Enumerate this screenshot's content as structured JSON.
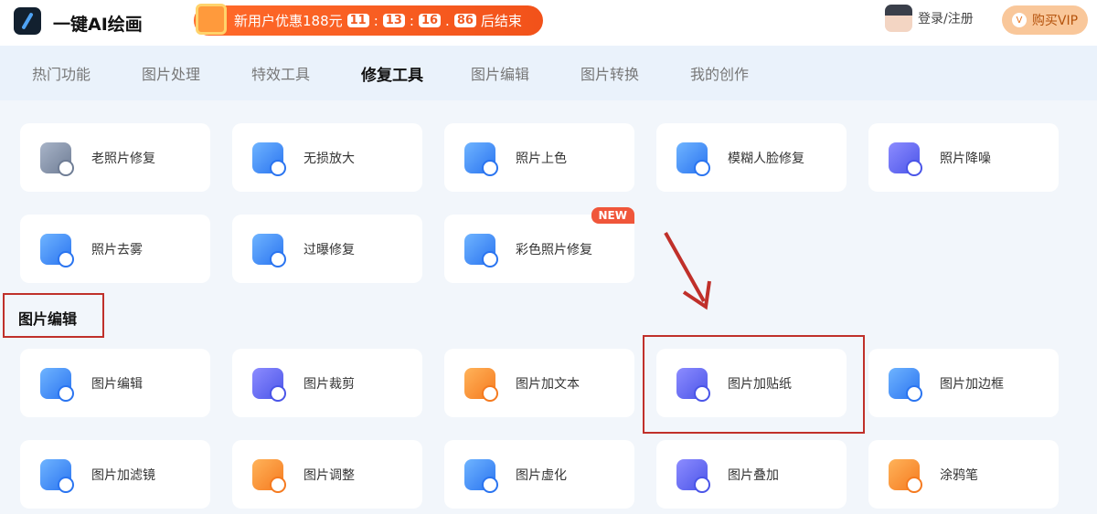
{
  "header": {
    "brand": "一键AI绘画",
    "promo": {
      "text": "新用户优惠188元",
      "timer": [
        "11",
        "13",
        "16",
        "86"
      ],
      "suffix": "后结束"
    },
    "login": "登录/注册",
    "vip": "购买VIP",
    "vip_icon": "V"
  },
  "tabs": [
    "热门功能",
    "图片处理",
    "特效工具",
    "修复工具",
    "图片编辑",
    "图片转换",
    "我的创作"
  ],
  "active_tab": "修复工具",
  "repair_tools": [
    {
      "label": "老照片修复",
      "color": "gray"
    },
    {
      "label": "无损放大",
      "color": "blue"
    },
    {
      "label": "照片上色",
      "color": "blue"
    },
    {
      "label": "模糊人脸修复",
      "color": "blue"
    },
    {
      "label": "照片降噪",
      "color": "purple"
    },
    {
      "label": "照片去雾",
      "color": "blue"
    },
    {
      "label": "过曝修复",
      "color": "blue"
    },
    {
      "label": "彩色照片修复",
      "color": "blue",
      "badge": "NEW"
    }
  ],
  "section_title": "图片编辑",
  "edit_tools": [
    {
      "label": "图片编辑",
      "color": "blue"
    },
    {
      "label": "图片裁剪",
      "color": "purple"
    },
    {
      "label": "图片加文本",
      "color": "orange"
    },
    {
      "label": "图片加贴纸",
      "color": "purple"
    },
    {
      "label": "图片加边框",
      "color": "blue"
    },
    {
      "label": "图片加滤镜",
      "color": "blue"
    },
    {
      "label": "图片调整",
      "color": "orange"
    },
    {
      "label": "图片虚化",
      "color": "blue"
    },
    {
      "label": "图片叠加",
      "color": "purple"
    },
    {
      "label": "涂鸦笔",
      "color": "orange"
    }
  ]
}
